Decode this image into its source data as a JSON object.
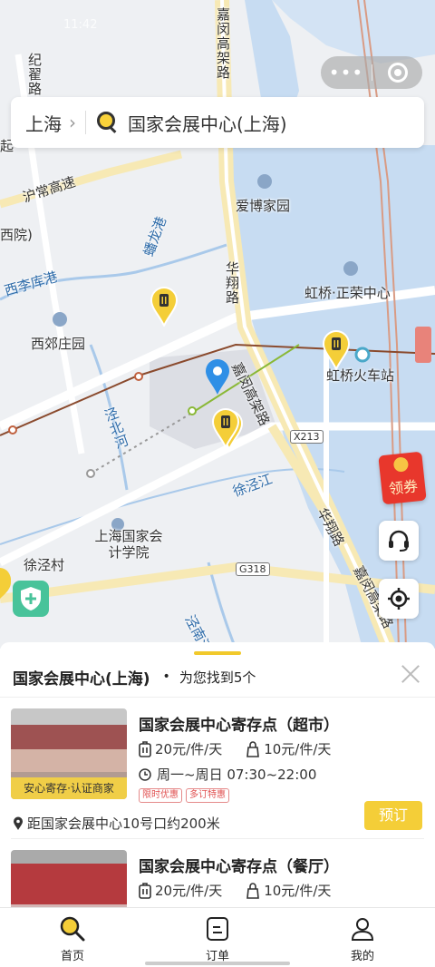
{
  "status": {
    "time": "11:42"
  },
  "search": {
    "city": "上海",
    "arrow": "›",
    "query": "国家会展中心(上海)"
  },
  "map": {
    "labels": {
      "jiagao": "嘉闵高架路",
      "qihua": "纪翟路",
      "hutong": "沪常高速",
      "xiyuan": "西院)",
      "hulong": "蟠龙港",
      "xili": "西李库港",
      "xijiao": "西郊庄园",
      "aibo": "爱博家园",
      "huaxiang": "华翔路",
      "hongqiao_zr": "虹桥·正荣中心",
      "hongqiao_hc": "虹桥火车站",
      "jiamin2": "嘉闵高架路",
      "jingbei": "泾北河",
      "xujing": "徐泾江",
      "kuaiji": "上海国家会计学院",
      "xujingcun": "徐泾村",
      "huaxiang2": "华翔路",
      "jiamin3": "嘉闵高架路",
      "jingnan": "泾南河",
      "x213": "X213",
      "g318": "G318",
      "qi": "起"
    },
    "coupon_label": "领券"
  },
  "sheet": {
    "title": "国家会展中心(上海)",
    "dot": "•",
    "count": "为您找到5个"
  },
  "cards": [
    {
      "title": "国家会展中心寄存点（超市）",
      "price_luggage": "20元/件/天",
      "price_bag": "10元/件/天",
      "hours": "周一~周日 07:30~22:00",
      "tags": [
        "限时优惠",
        "多订特惠"
      ],
      "badge": "安心寄存·认证商家",
      "distance": "距国家会展中心10号口约200米",
      "book": "预订"
    },
    {
      "title": "国家会展中心寄存点（餐厅）",
      "price_luggage": "20元/件/天",
      "price_bag": "10元/件/天"
    }
  ],
  "tabs": [
    {
      "label": "首页",
      "icon": "search-icon"
    },
    {
      "label": "订单",
      "icon": "order-icon"
    },
    {
      "label": "我的",
      "icon": "profile-icon"
    }
  ],
  "colors": {
    "accent": "#f4ce38",
    "water": "#c7dcf2",
    "map_bg": "#eef0f3",
    "route": "#8a4a2d"
  }
}
